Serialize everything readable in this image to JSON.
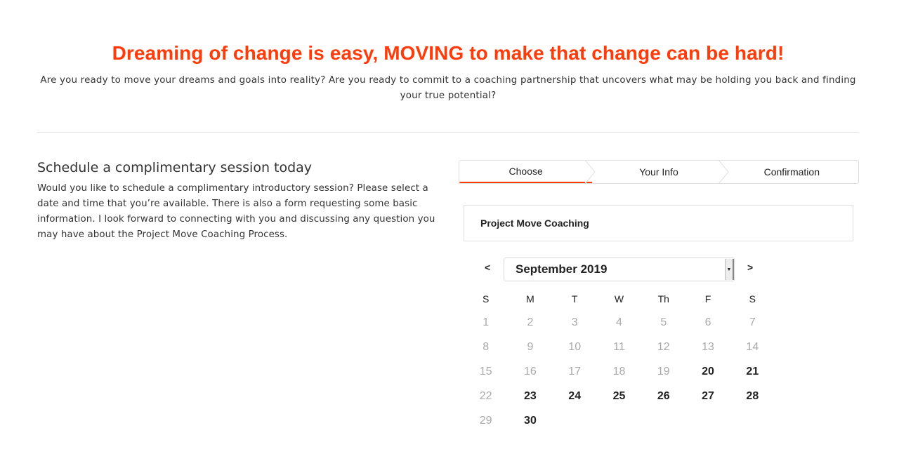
{
  "hero": {
    "title": "Dreaming of change is easy, MOVING to make that change can be hard!",
    "subtitle": "Are you ready to move your dreams and goals into reality? Are you ready to commit to a coaching partnership that uncovers what may be holding you back and finding your true potential?"
  },
  "intro": {
    "title": "Schedule a complimentary session today",
    "text": "Would you like to schedule a complimentary introductory session? Please select a date and time that you’re available. There is also a form requesting some basic information. I look forward to connecting with you and discussing any question you may have about the Project Move Coaching Process."
  },
  "steps": [
    {
      "label": "Choose",
      "active": true
    },
    {
      "label": "Your Info",
      "active": false
    },
    {
      "label": "Confirmation",
      "active": false
    }
  ],
  "service": {
    "name": "Project Move Coaching"
  },
  "calendar": {
    "prev_label": "<",
    "next_label": ">",
    "month_label": "September 2019",
    "weekdays": [
      "S",
      "M",
      "T",
      "W",
      "Th",
      "F",
      "S"
    ],
    "weeks": [
      [
        {
          "d": "1",
          "a": false
        },
        {
          "d": "2",
          "a": false
        },
        {
          "d": "3",
          "a": false
        },
        {
          "d": "4",
          "a": false
        },
        {
          "d": "5",
          "a": false
        },
        {
          "d": "6",
          "a": false
        },
        {
          "d": "7",
          "a": false
        }
      ],
      [
        {
          "d": "8",
          "a": false
        },
        {
          "d": "9",
          "a": false
        },
        {
          "d": "10",
          "a": false
        },
        {
          "d": "11",
          "a": false
        },
        {
          "d": "12",
          "a": false
        },
        {
          "d": "13",
          "a": false
        },
        {
          "d": "14",
          "a": false
        }
      ],
      [
        {
          "d": "15",
          "a": false
        },
        {
          "d": "16",
          "a": false
        },
        {
          "d": "17",
          "a": false
        },
        {
          "d": "18",
          "a": false
        },
        {
          "d": "19",
          "a": false
        },
        {
          "d": "20",
          "a": true
        },
        {
          "d": "21",
          "a": true
        }
      ],
      [
        {
          "d": "22",
          "a": false
        },
        {
          "d": "23",
          "a": true
        },
        {
          "d": "24",
          "a": true
        },
        {
          "d": "25",
          "a": true
        },
        {
          "d": "26",
          "a": true
        },
        {
          "d": "27",
          "a": true
        },
        {
          "d": "28",
          "a": true
        }
      ],
      [
        {
          "d": "29",
          "a": false
        },
        {
          "d": "30",
          "a": true
        }
      ]
    ]
  },
  "colors": {
    "accent": "#ff3b0a"
  }
}
